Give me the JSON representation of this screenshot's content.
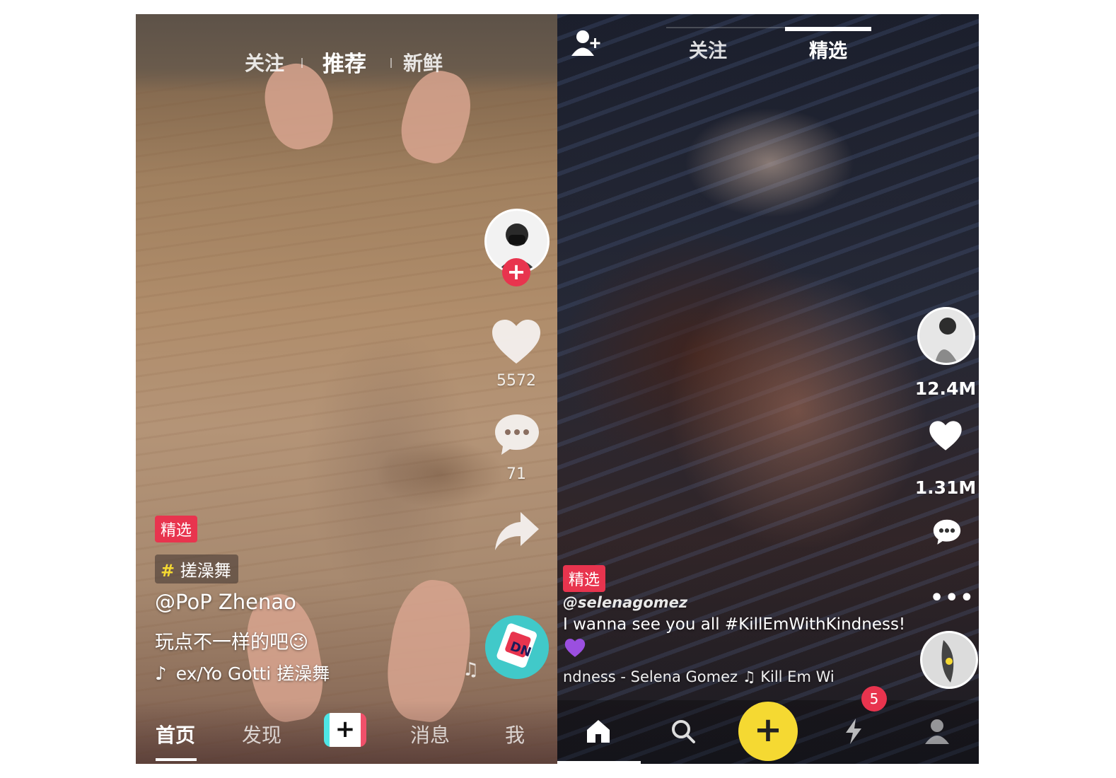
{
  "left": {
    "top_tabs": [
      {
        "label": "关注",
        "active": false
      },
      {
        "label": "推荐",
        "active": true
      },
      {
        "label": "新鲜",
        "active": false
      }
    ],
    "like_count": "5572",
    "comment_count": "71",
    "featured_tag": "精选",
    "hashtag": "搓澡舞",
    "username": "@PoP Zhenao",
    "caption": "玩点不一样的吧😉",
    "music": "ex/Yo Gotti    搓澡舞",
    "bottom_nav": [
      {
        "label": "首页",
        "active": true
      },
      {
        "label": "发现",
        "active": false
      },
      {
        "label": "消息",
        "active": false
      },
      {
        "label": "我",
        "active": false
      }
    ],
    "add_button": "+"
  },
  "right": {
    "top_tabs": [
      {
        "label": "关注",
        "active": false
      },
      {
        "label": "精选",
        "active": true
      }
    ],
    "like_count": "12.4M",
    "comment_count": "1.31M",
    "featured_tag": "精选",
    "username": "@selenagomez",
    "caption": "I wanna see you all #KillEmWithKindness!",
    "music": "ndness - Selena Gomez    ♫ Kill Em Wi",
    "notification_badge": "5",
    "add_button": "+",
    "colors": {
      "add_button_bg": "#f5d932",
      "badge_bg": "#e8344e"
    }
  },
  "colors": {
    "accent_red": "#e8344e"
  }
}
